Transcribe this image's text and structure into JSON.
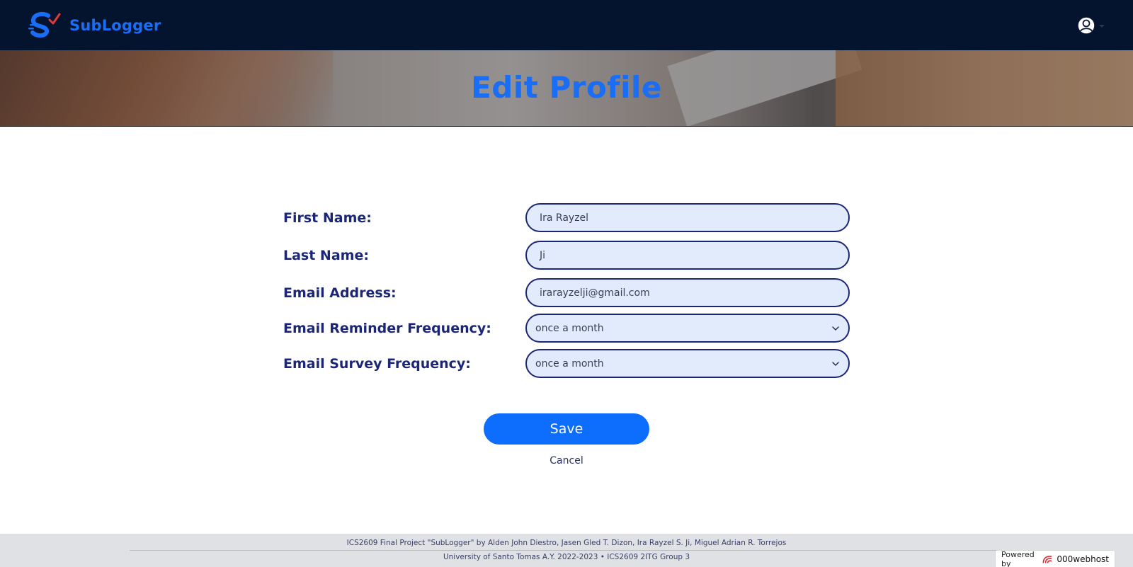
{
  "nav": {
    "brand": "SubLogger",
    "colors": {
      "background": "#04132e",
      "brand": "#1a6ef5"
    },
    "profile_icon": "user-circle-icon"
  },
  "hero": {
    "title": "Edit Profile"
  },
  "form": {
    "first_name": {
      "label": "First Name:",
      "value": "Ira Rayzel"
    },
    "last_name": {
      "label": "Last Name:",
      "value": "Ji"
    },
    "email": {
      "label": "Email Address:",
      "value": "irarayzelji@gmail.com"
    },
    "reminder_frequency": {
      "label": "Email Reminder Frequency:",
      "value": "once a month"
    },
    "survey_frequency": {
      "label": "Email Survey Frequency:",
      "value": "once a month"
    },
    "colors": {
      "label": "#1c2677",
      "field_bg": "#e1ebfb",
      "field_border": "#1c2677"
    }
  },
  "actions": {
    "save": "Save",
    "cancel": "Cancel",
    "save_color": "#0d6efd"
  },
  "footer": {
    "line1": "ICS2609 Final Project \"SubLogger\" by Alden John Diestro, Jasen Gled T. Dizon, Ira Rayzel S. Ji, Miguel Adrian R. Torrejos",
    "line2": "University of Santo Tomas A.Y. 2022-2023 • ICS2609 2ITG Group 3"
  },
  "badge": {
    "prefix": "Powered by",
    "brand": "000webhost"
  }
}
